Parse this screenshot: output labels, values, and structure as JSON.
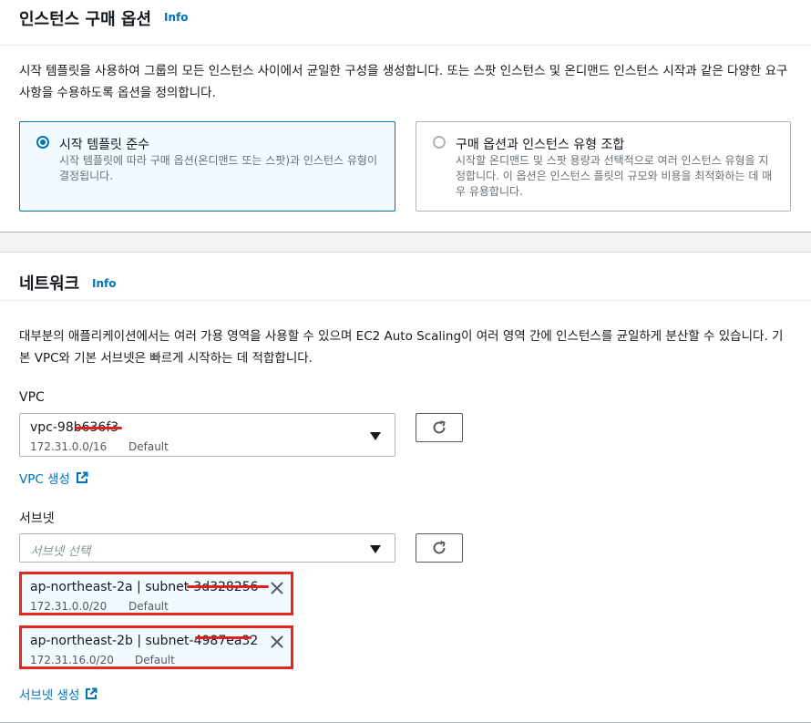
{
  "purchase": {
    "title": "인스턴스 구매 옵션",
    "info": "Info",
    "description": "시작 템플릿을 사용하여 그룹의 모든 인스턴스 사이에서 균일한 구성을 생성합니다. 또는 스팟 인스턴스 및 온디맨드 인스턴스 시작과 같은 다양한 요구 사항을 수용하도록 옵션을 정의합니다.",
    "options": [
      {
        "label": "시작 템플릿 준수",
        "description": "시작 템플릿에 따라 구매 옵션(온디맨드 또는 스팟)과 인스턴스 유형이 결정됩니다.",
        "selected": true
      },
      {
        "label": "구매 옵션과 인스턴스 유형 조합",
        "description": "시작할 온디맨드 및 스팟 용량과 선택적으로 여러 인스턴스 유형을 지정합니다. 이 옵션은 인스턴스 플릿의 규모와 비용을 최적화하는 데 매우 유용합니다.",
        "selected": false
      }
    ]
  },
  "network": {
    "title": "네트워크",
    "info": "Info",
    "description": "대부분의 애플리케이션에서는 여러 가용 영역을 사용할 수 있으며 EC2 Auto Scaling이 여러 영역 간에 인스턴스를 균일하게 분산할 수 있습니다. 기본 VPC와 기본 서브넷은 빠르게 시작하는 데 적합합니다.",
    "vpc": {
      "label": "VPC",
      "value": "vpc-98b636f3",
      "cidr": "172.31.0.0/16",
      "tag": "Default",
      "create_link": "VPC 생성"
    },
    "subnet": {
      "label": "서브넷",
      "placeholder": "서브넷 선택",
      "create_link": "서브넷 생성",
      "selected": [
        {
          "title": "ap-northeast-2a | subnet-3d328256",
          "cidr": "172.31.0.0/20",
          "tag": "Default"
        },
        {
          "title": "ap-northeast-2b | subnet-4987ea32",
          "cidr": "172.31.16.0/20",
          "tag": "Default"
        }
      ]
    }
  },
  "colors": {
    "link": "#0073bb",
    "selected_bg": "#f1faff",
    "highlight_border": "#e4261f",
    "redaction": "#e0201c"
  },
  "icons": {
    "refresh": "refresh-icon",
    "external": "external-link-icon",
    "remove": "close-icon",
    "dropdown": "caret-down-icon"
  }
}
